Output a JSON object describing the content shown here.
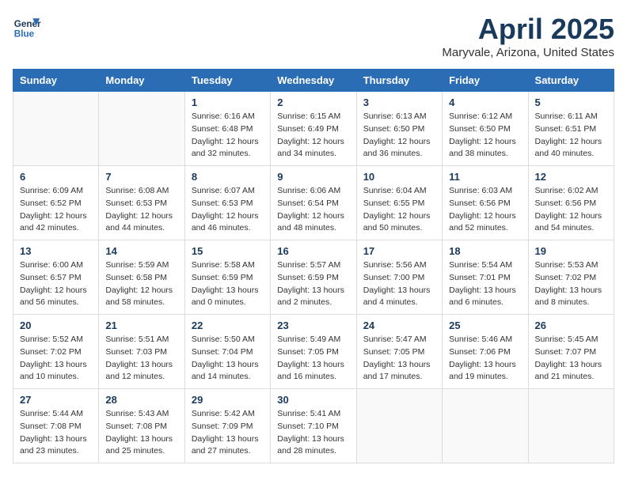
{
  "header": {
    "logo_line1": "General",
    "logo_line2": "Blue",
    "month": "April 2025",
    "location": "Maryvale, Arizona, United States"
  },
  "days_of_week": [
    "Sunday",
    "Monday",
    "Tuesday",
    "Wednesday",
    "Thursday",
    "Friday",
    "Saturday"
  ],
  "weeks": [
    [
      {
        "day": "",
        "content": ""
      },
      {
        "day": "",
        "content": ""
      },
      {
        "day": "1",
        "content": "Sunrise: 6:16 AM\nSunset: 6:48 PM\nDaylight: 12 hours\nand 32 minutes."
      },
      {
        "day": "2",
        "content": "Sunrise: 6:15 AM\nSunset: 6:49 PM\nDaylight: 12 hours\nand 34 minutes."
      },
      {
        "day": "3",
        "content": "Sunrise: 6:13 AM\nSunset: 6:50 PM\nDaylight: 12 hours\nand 36 minutes."
      },
      {
        "day": "4",
        "content": "Sunrise: 6:12 AM\nSunset: 6:50 PM\nDaylight: 12 hours\nand 38 minutes."
      },
      {
        "day": "5",
        "content": "Sunrise: 6:11 AM\nSunset: 6:51 PM\nDaylight: 12 hours\nand 40 minutes."
      }
    ],
    [
      {
        "day": "6",
        "content": "Sunrise: 6:09 AM\nSunset: 6:52 PM\nDaylight: 12 hours\nand 42 minutes."
      },
      {
        "day": "7",
        "content": "Sunrise: 6:08 AM\nSunset: 6:53 PM\nDaylight: 12 hours\nand 44 minutes."
      },
      {
        "day": "8",
        "content": "Sunrise: 6:07 AM\nSunset: 6:53 PM\nDaylight: 12 hours\nand 46 minutes."
      },
      {
        "day": "9",
        "content": "Sunrise: 6:06 AM\nSunset: 6:54 PM\nDaylight: 12 hours\nand 48 minutes."
      },
      {
        "day": "10",
        "content": "Sunrise: 6:04 AM\nSunset: 6:55 PM\nDaylight: 12 hours\nand 50 minutes."
      },
      {
        "day": "11",
        "content": "Sunrise: 6:03 AM\nSunset: 6:56 PM\nDaylight: 12 hours\nand 52 minutes."
      },
      {
        "day": "12",
        "content": "Sunrise: 6:02 AM\nSunset: 6:56 PM\nDaylight: 12 hours\nand 54 minutes."
      }
    ],
    [
      {
        "day": "13",
        "content": "Sunrise: 6:00 AM\nSunset: 6:57 PM\nDaylight: 12 hours\nand 56 minutes."
      },
      {
        "day": "14",
        "content": "Sunrise: 5:59 AM\nSunset: 6:58 PM\nDaylight: 12 hours\nand 58 minutes."
      },
      {
        "day": "15",
        "content": "Sunrise: 5:58 AM\nSunset: 6:59 PM\nDaylight: 13 hours\nand 0 minutes."
      },
      {
        "day": "16",
        "content": "Sunrise: 5:57 AM\nSunset: 6:59 PM\nDaylight: 13 hours\nand 2 minutes."
      },
      {
        "day": "17",
        "content": "Sunrise: 5:56 AM\nSunset: 7:00 PM\nDaylight: 13 hours\nand 4 minutes."
      },
      {
        "day": "18",
        "content": "Sunrise: 5:54 AM\nSunset: 7:01 PM\nDaylight: 13 hours\nand 6 minutes."
      },
      {
        "day": "19",
        "content": "Sunrise: 5:53 AM\nSunset: 7:02 PM\nDaylight: 13 hours\nand 8 minutes."
      }
    ],
    [
      {
        "day": "20",
        "content": "Sunrise: 5:52 AM\nSunset: 7:02 PM\nDaylight: 13 hours\nand 10 minutes."
      },
      {
        "day": "21",
        "content": "Sunrise: 5:51 AM\nSunset: 7:03 PM\nDaylight: 13 hours\nand 12 minutes."
      },
      {
        "day": "22",
        "content": "Sunrise: 5:50 AM\nSunset: 7:04 PM\nDaylight: 13 hours\nand 14 minutes."
      },
      {
        "day": "23",
        "content": "Sunrise: 5:49 AM\nSunset: 7:05 PM\nDaylight: 13 hours\nand 16 minutes."
      },
      {
        "day": "24",
        "content": "Sunrise: 5:47 AM\nSunset: 7:05 PM\nDaylight: 13 hours\nand 17 minutes."
      },
      {
        "day": "25",
        "content": "Sunrise: 5:46 AM\nSunset: 7:06 PM\nDaylight: 13 hours\nand 19 minutes."
      },
      {
        "day": "26",
        "content": "Sunrise: 5:45 AM\nSunset: 7:07 PM\nDaylight: 13 hours\nand 21 minutes."
      }
    ],
    [
      {
        "day": "27",
        "content": "Sunrise: 5:44 AM\nSunset: 7:08 PM\nDaylight: 13 hours\nand 23 minutes."
      },
      {
        "day": "28",
        "content": "Sunrise: 5:43 AM\nSunset: 7:08 PM\nDaylight: 13 hours\nand 25 minutes."
      },
      {
        "day": "29",
        "content": "Sunrise: 5:42 AM\nSunset: 7:09 PM\nDaylight: 13 hours\nand 27 minutes."
      },
      {
        "day": "30",
        "content": "Sunrise: 5:41 AM\nSunset: 7:10 PM\nDaylight: 13 hours\nand 28 minutes."
      },
      {
        "day": "",
        "content": ""
      },
      {
        "day": "",
        "content": ""
      },
      {
        "day": "",
        "content": ""
      }
    ]
  ]
}
